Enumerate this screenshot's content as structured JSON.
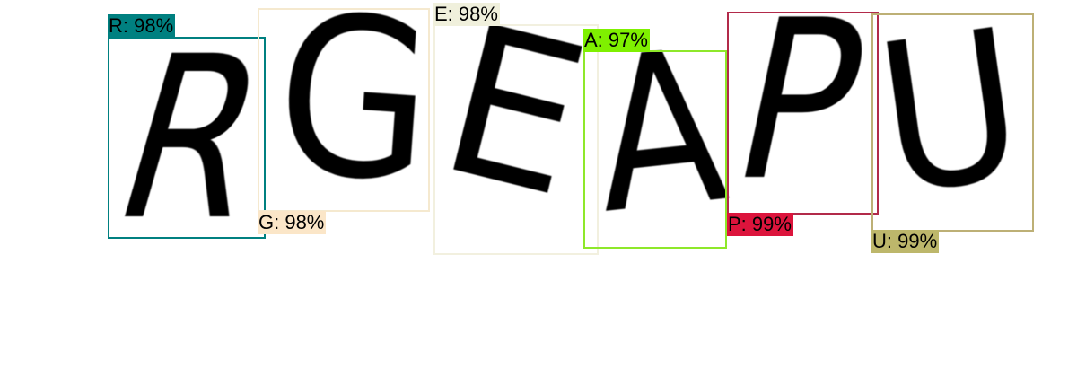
{
  "detections": [
    {
      "glyph": "R",
      "label": "R: 98%",
      "color": "#008080",
      "tag_bg": "#008080"
    },
    {
      "glyph": "G",
      "label": "G: 98%",
      "color": "#f5e9cf",
      "tag_bg": "#fbe6c8"
    },
    {
      "glyph": "E",
      "label": "E: 98%",
      "color": "#f2f0df",
      "tag_bg": "#f0f0dc"
    },
    {
      "glyph": "A",
      "label": "A: 97%",
      "color": "#8ee82a",
      "tag_bg": "#7ff000"
    },
    {
      "glyph": "P",
      "label": "P: 99%",
      "color": "#b22a4a",
      "tag_bg": "#dc143c"
    },
    {
      "glyph": "U",
      "label": "U: 99%",
      "color": "#bdb076",
      "tag_bg": "#bdb76b"
    }
  ]
}
